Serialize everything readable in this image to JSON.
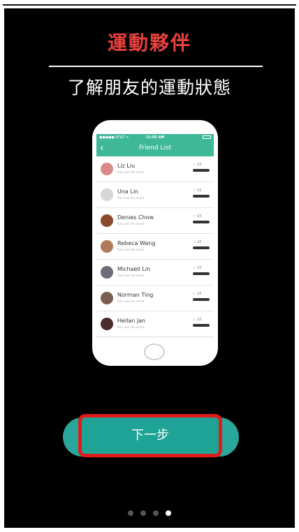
{
  "page": {
    "title": "運動夥伴",
    "subtitle": "了解朋友的運動狀態",
    "next_label": "下一步",
    "page_count": 4,
    "current_page": 4
  },
  "phone": {
    "status": {
      "carrier": "●●●●● AT&T ᯤ",
      "time": "11:56 AM"
    },
    "header_title": "Friend List",
    "back_icon": "chevron-left-icon",
    "friends": [
      {
        "name": "Liz  Liu",
        "subtitle": "Run over the world",
        "star_label": "☆ 10",
        "progress": 0.6,
        "avatar_color": "#d98b8b"
      },
      {
        "name": "Una Lin",
        "subtitle": "Run over the world",
        "star_label": "☆ 10",
        "progress": 0.6,
        "avatar_color": "#d6d6d6"
      },
      {
        "name": "Denies Chow",
        "subtitle": "Run over the world",
        "star_label": "☆ 10",
        "progress": 0.6,
        "avatar_color": "#8a4a2e"
      },
      {
        "name": "Rebeca Wang",
        "subtitle": "Run over the world",
        "star_label": "☆ 10",
        "progress": 0.6,
        "avatar_color": "#b07a5a"
      },
      {
        "name": "Michaell Lin",
        "subtitle": "Run over the world",
        "star_label": "☆ 10",
        "progress": 0.6,
        "avatar_color": "#6d6d7a"
      },
      {
        "name": "Norman Ting",
        "subtitle": "Run over the world",
        "star_label": "☆ 10",
        "progress": 0.6,
        "avatar_color": "#7a6050"
      },
      {
        "name": "Hellan Jan",
        "subtitle": "Run over the world",
        "star_label": "☆ 10",
        "progress": 0.6,
        "avatar_color": "#4a2e2a"
      }
    ]
  },
  "colors": {
    "title": "#e8413f",
    "accent": "#3fb897",
    "button": "#1fa396",
    "highlight_border": "#e01b1b"
  }
}
